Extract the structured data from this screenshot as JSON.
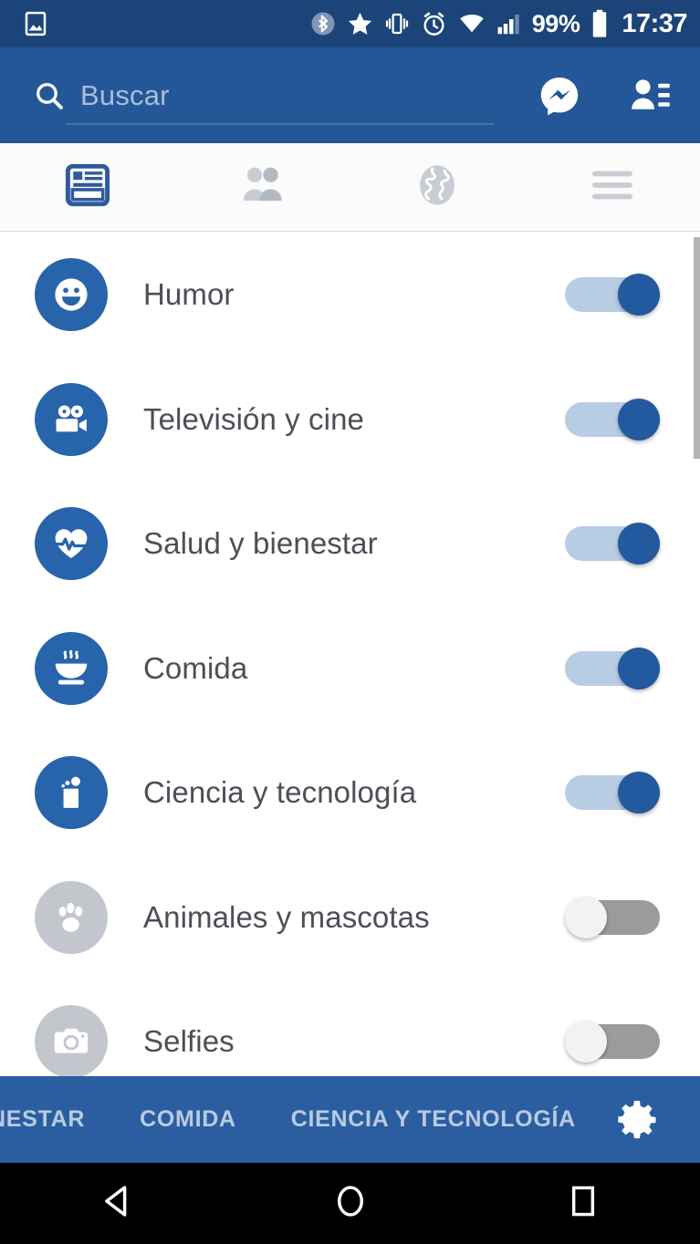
{
  "status_bar": {
    "icons": [
      "image-icon",
      "bluetooth-icon",
      "star-icon",
      "vibrate-icon",
      "alarm-icon",
      "wifi-icon",
      "signal-icon"
    ],
    "battery_percent": "99%",
    "clock": "17:37",
    "background": "#1c4478"
  },
  "header": {
    "background": "#245798",
    "search": {
      "placeholder": "Buscar",
      "value": "",
      "icon": "search-icon"
    },
    "actions": [
      {
        "name": "messenger-icon",
        "label": "Messenger"
      },
      {
        "name": "contacts-icon",
        "label": "Contactos"
      }
    ]
  },
  "tabs": [
    {
      "name": "tab-news-feed",
      "icon": "news-feed-icon",
      "label": "Noticias",
      "selected": true
    },
    {
      "name": "tab-friends",
      "icon": "friends-icon",
      "label": "Solicitudes",
      "selected": false
    },
    {
      "name": "tab-globe",
      "icon": "globe-icon",
      "label": "Notificaciones",
      "selected": false
    },
    {
      "name": "tab-menu",
      "icon": "hamburger-menu-icon",
      "label": "Más",
      "selected": false
    }
  ],
  "list": {
    "rows": [
      {
        "label": "Humor",
        "icon": "smiley-icon",
        "enabled": true
      },
      {
        "label": "Televisión y cine",
        "icon": "movie-camera-icon",
        "enabled": true
      },
      {
        "label": "Salud y bienestar",
        "icon": "heartbeat-icon",
        "enabled": true
      },
      {
        "label": "Comida",
        "icon": "soup-bowl-icon",
        "enabled": true
      },
      {
        "label": "Ciencia y tecnología",
        "icon": "beaker-icon",
        "enabled": true
      },
      {
        "label": "Animales y mascotas",
        "icon": "paw-print-icon",
        "enabled": false
      },
      {
        "label": "Selfies",
        "icon": "camera-icon",
        "enabled": false
      }
    ],
    "toggle_on_color": "#23599e",
    "toggle_off_color": "#9b9b9b",
    "icon_on_color": "#2764ab",
    "icon_off_color": "#c3c6cc"
  },
  "category_bar": {
    "background": "#2b5ea1",
    "items": [
      "NESTAR",
      "COMIDA",
      "CIENCIA Y TECNOLOGÍA"
    ],
    "settings_icon": "gear-icon"
  },
  "nav_bar": {
    "buttons": [
      {
        "name": "back-button",
        "icon": "triangle-back-icon"
      },
      {
        "name": "home-button",
        "icon": "circle-home-icon"
      },
      {
        "name": "recents-button",
        "icon": "square-recents-icon"
      }
    ]
  }
}
